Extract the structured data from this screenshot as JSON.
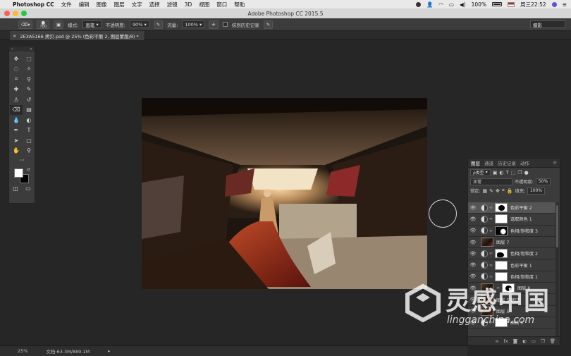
{
  "menubar": {
    "app_name": "Photoshop CC",
    "items": [
      "文件",
      "编辑",
      "图像",
      "图层",
      "文字",
      "选择",
      "滤镜",
      "3D",
      "视图",
      "窗口",
      "帮助"
    ],
    "battery": "100%",
    "clock": "周三22:52"
  },
  "window": {
    "title": "Adobe Photoshop CC 2015.5"
  },
  "options": {
    "brush_size": "700",
    "mode_label": "模式:",
    "mode_value": "画笔",
    "opacity_label": "不透明度:",
    "opacity_value": "90%",
    "flow_label": "流量:",
    "flow_value": "100%",
    "erase_history_label": "抹到历史记录",
    "workspace": "摄影"
  },
  "document_tab": {
    "title": "2E3A5166 拷贝.psd @ 25% (色彩平衡 2, 图层蒙版/8) *",
    "close": "×"
  },
  "toolbar": {
    "tools": [
      "move-tool",
      "marquee-tool",
      "lasso-tool",
      "quick-select-tool",
      "crop-tool",
      "eyedropper-tool",
      "healing-brush-tool",
      "brush-tool",
      "clone-stamp-tool",
      "history-brush-tool",
      "eraser-tool",
      "gradient-tool",
      "blur-tool",
      "dodge-tool",
      "pen-tool",
      "type-tool",
      "path-select-tool",
      "rectangle-tool",
      "hand-tool",
      "zoom-tool"
    ],
    "more": "···"
  },
  "colors": {
    "foreground": "#ffffff",
    "background": "#000000",
    "accent": "#555555"
  },
  "layers_panel": {
    "tabs": [
      "图层",
      "通道",
      "历史记录",
      "动作"
    ],
    "filter_kind": "ρ类型",
    "blend_mode": "正常",
    "opacity_label": "不透明度:",
    "opacity_value": "50%",
    "lock_label": "锁定:",
    "fill_label": "填充:",
    "fill_value": "100%",
    "layers": [
      {
        "name": "色彩平衡 2",
        "type": "adjustment",
        "selected": true
      },
      {
        "name": "选取颜色 1",
        "type": "adjustment",
        "selected": false
      },
      {
        "name": "色相/饱和度 3",
        "type": "adjustment",
        "selected": false
      },
      {
        "name": "图层 7",
        "type": "pixel",
        "selected": false
      },
      {
        "name": "色相/饱和度 2",
        "type": "adjustment",
        "selected": false
      },
      {
        "name": "色彩平衡 1",
        "type": "adjustment",
        "selected": false
      },
      {
        "name": "色相/饱和度 1",
        "type": "adjustment",
        "selected": false
      },
      {
        "name": "图层 6",
        "type": "pixel",
        "selected": false
      },
      {
        "name": "图层 5 拷贝",
        "type": "pixel",
        "selected": false
      },
      {
        "name": "图层 5",
        "type": "pixel",
        "selected": false
      },
      {
        "name": "曲线 1",
        "type": "adjustment",
        "selected": false
      }
    ],
    "footer_icons": [
      "link-layers-icon",
      "fx-icon",
      "add-mask-icon",
      "adjustment-icon",
      "group-icon",
      "new-layer-icon",
      "trash-icon"
    ]
  },
  "status": {
    "zoom": "25%",
    "doc_size": "文档:63.3M/889.1M"
  },
  "watermark": {
    "title": "灵感中国",
    "url": "lingganchina.com"
  }
}
